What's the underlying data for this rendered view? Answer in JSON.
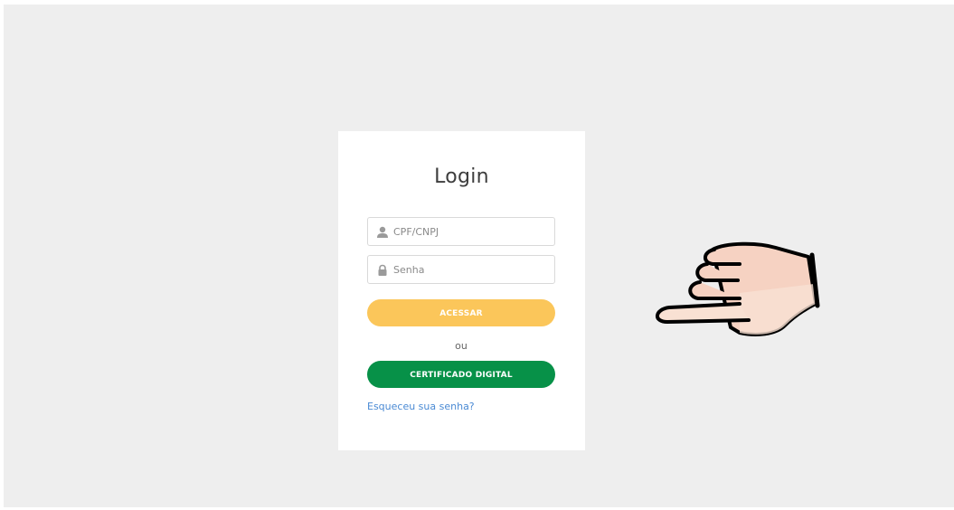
{
  "login": {
    "title": "Login",
    "username_placeholder": "CPF/CNPJ",
    "username_icon": "user-icon",
    "password_placeholder": "Senha",
    "password_icon": "lock-icon",
    "submit_label": "ACESSAR",
    "or_label": "ou",
    "certificate_label": "CERTIFICADO DIGITAL",
    "forgot_label": "Esqueceu sua senha?"
  },
  "overlay": {
    "cursor_icon": "pointing-hand-icon"
  },
  "colors": {
    "background": "#eeeeee",
    "card": "#ffffff",
    "primary_button": "#fbc65a",
    "certificate_button": "#079148",
    "link": "#4a8ad4"
  }
}
